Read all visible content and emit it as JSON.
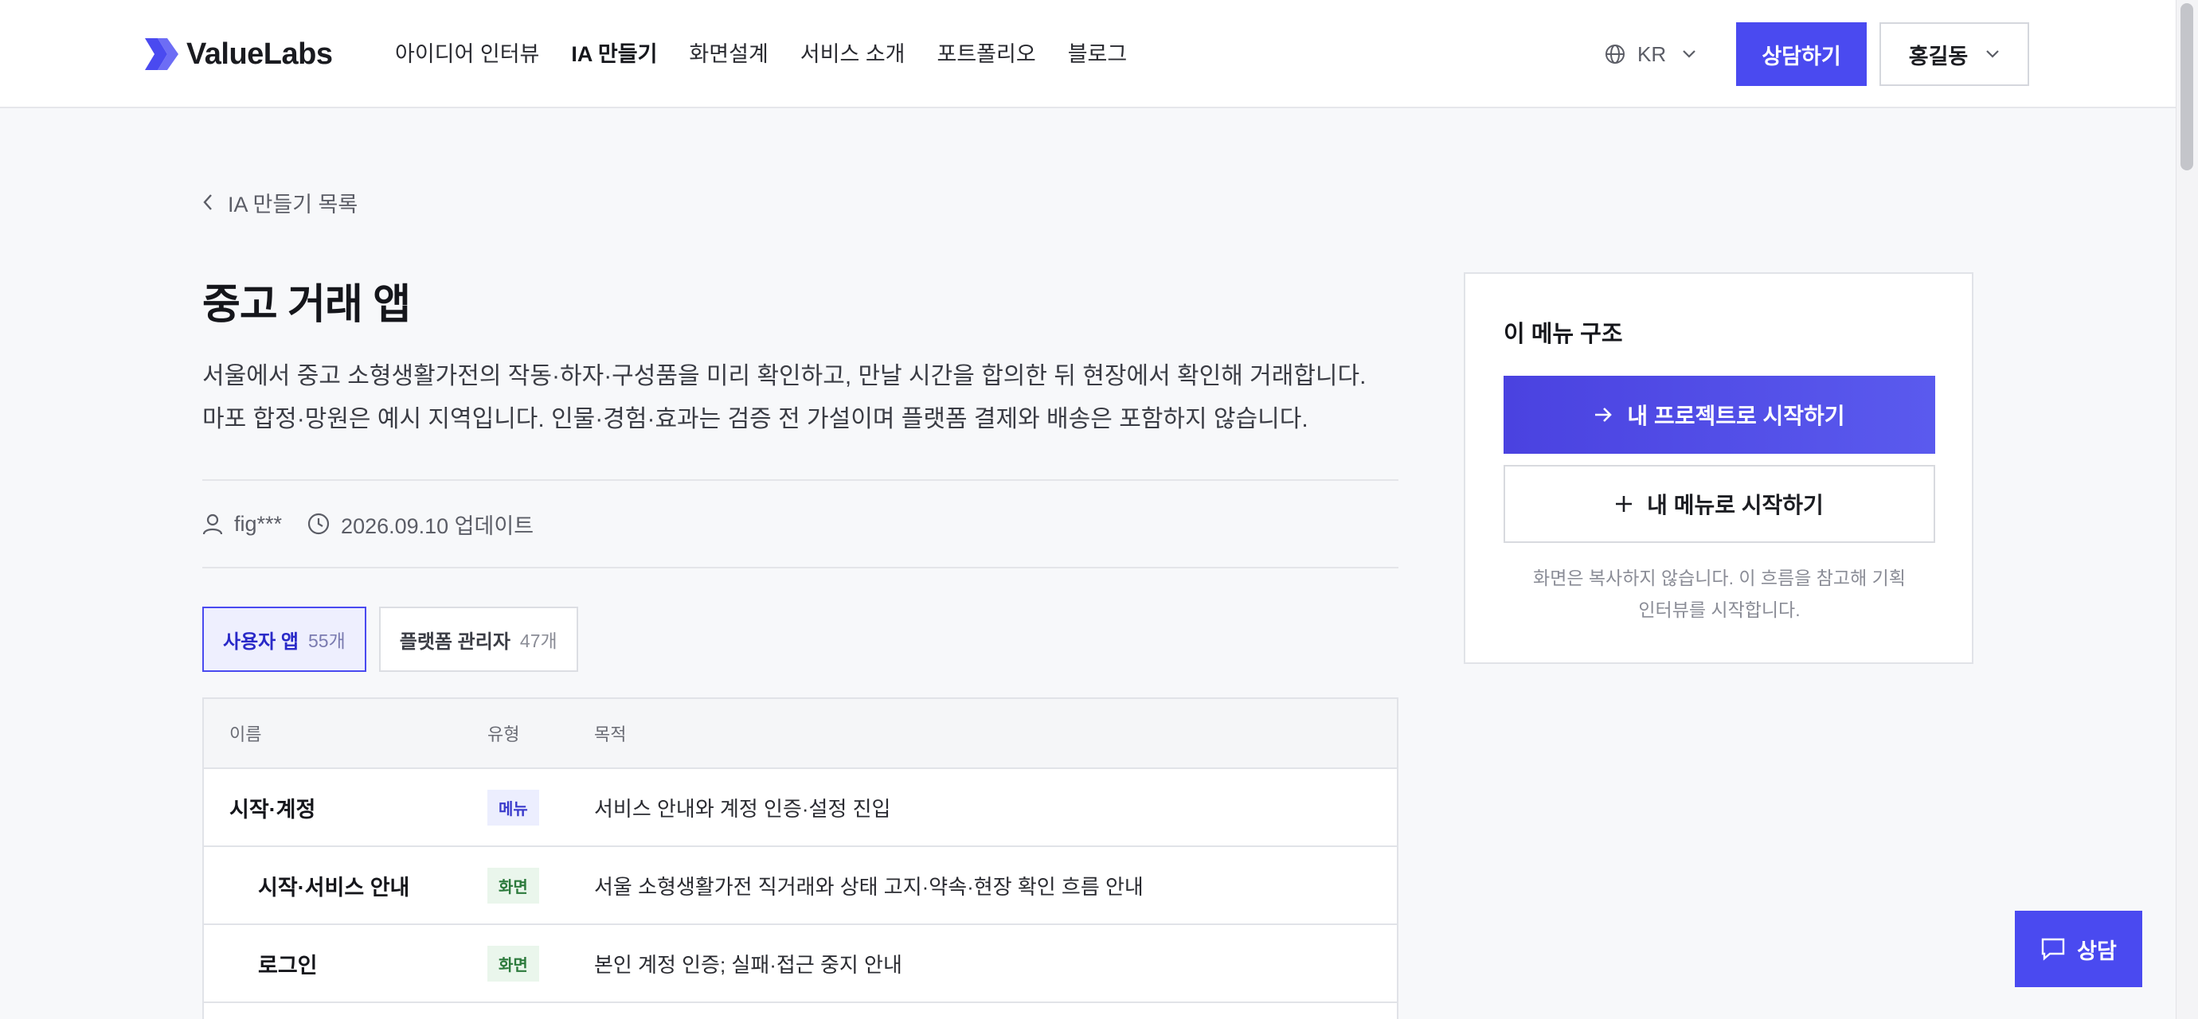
{
  "header": {
    "logo_text": "ValueLabs",
    "nav": [
      {
        "label": "아이디어 인터뷰",
        "active": false
      },
      {
        "label": "IA 만들기",
        "active": true
      },
      {
        "label": "화면설계",
        "active": false
      },
      {
        "label": "서비스 소개",
        "active": false
      },
      {
        "label": "포트폴리오",
        "active": false
      },
      {
        "label": "블로그",
        "active": false
      }
    ],
    "language": "KR",
    "consult_label": "상담하기",
    "user_name": "홍길동"
  },
  "breadcrumb": {
    "back_label": "IA 만들기 목록"
  },
  "page": {
    "title": "중고 거래 앱",
    "description": [
      "서울에서 중고 소형생활가전의 작동·하자·구성품을 미리 확인하고, 만날 시간을 합의한 뒤 현장에서 확인해 거래합니다.",
      "마포 합정·망원은 예시 지역입니다. 인물·경험·효과는 검증 전 가설이며 플랫폼 결제와 배송은 포함하지 않습니다."
    ],
    "author": "fig***",
    "updated": "2026.09.10 업데이트"
  },
  "tabs": [
    {
      "label": "사용자 앱",
      "count": "55개",
      "active": true
    },
    {
      "label": "플랫폼 관리자",
      "count": "47개",
      "active": false
    }
  ],
  "table": {
    "headers": {
      "name": "이름",
      "type": "유형",
      "purpose": "목적"
    },
    "rows": [
      {
        "name": "시작·계정",
        "type": "메뉴",
        "kind": "menu",
        "purpose": "서비스 안내와 계정 인증·설정 진입"
      },
      {
        "name": "시작·서비스 안내",
        "type": "화면",
        "kind": "screen",
        "purpose": "서울 소형생활가전 직거래와 상태 고지·약속·현장 확인 흐름 안내"
      },
      {
        "name": "로그인",
        "type": "화면",
        "kind": "screen",
        "purpose": "본인 계정 인증; 실패·접근 중지 안내"
      }
    ]
  },
  "side_card": {
    "title": "이 메뉴 구조",
    "primary_label": "내 프로젝트로 시작하기",
    "secondary_label": "내 메뉴로 시작하기",
    "note_line1": "화면은 복사하지 않습니다. 이 흐름을 참고해 기획",
    "note_line2": "인터뷰를 시작합니다."
  },
  "chat_fab": {
    "label": "상담"
  },
  "colors": {
    "accent": "#4a4af0",
    "menu_badge_bg": "#eceefe",
    "screen_badge_bg": "#eaf6ec"
  }
}
